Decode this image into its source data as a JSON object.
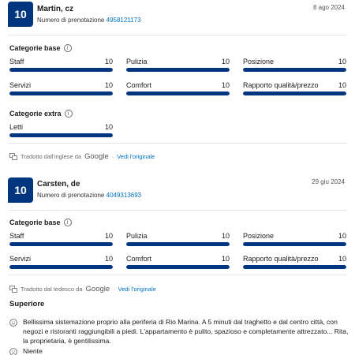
{
  "reviews": [
    {
      "score": "10",
      "name": "Martin, cz",
      "booking_label": "Numero di prenotazione",
      "booking_number": "4958121173",
      "date": "8 ago 2024",
      "base_title": "Categorie base",
      "base": [
        {
          "label": "Staff",
          "value": "10",
          "fill": 1.0
        },
        {
          "label": "Pulizia",
          "value": "10",
          "fill": 1.0
        },
        {
          "label": "Posizione",
          "value": "10",
          "fill": 1.0
        },
        {
          "label": "Servizi",
          "value": "10",
          "fill": 1.0
        },
        {
          "label": "Comfort",
          "value": "10",
          "fill": 1.0
        },
        {
          "label": "Rapporto qualità/prezzo",
          "value": "10",
          "fill": 1.0
        }
      ],
      "extra_title": "Categorie extra",
      "extra": [
        {
          "label": "Letti",
          "value": "10",
          "fill": 1.0
        }
      ],
      "translated_from": "Tradotto dall'inglese da",
      "google": "Google",
      "see_original": "Vedi l'originale"
    },
    {
      "score": "10",
      "name": "Carsten, de",
      "booking_label": "Numero di prenotazione",
      "booking_number": "4049313693",
      "date": "29 giu 2024",
      "base_title": "Categorie base",
      "base": [
        {
          "label": "Staff",
          "value": "10",
          "fill": 1.0
        },
        {
          "label": "Pulizia",
          "value": "10",
          "fill": 1.0
        },
        {
          "label": "Posizione",
          "value": "10",
          "fill": 1.0
        },
        {
          "label": "Servizi",
          "value": "10",
          "fill": 1.0
        },
        {
          "label": "Comfort",
          "value": "10",
          "fill": 1.0
        },
        {
          "label": "Rapporto qualità/prezzo",
          "value": "10",
          "fill": 1.0
        }
      ],
      "translated_from": "Tradotto dal tedesco da",
      "google": "Google",
      "see_original": "Vedi l'originale",
      "heading": "Superiore",
      "positive": "Bellissima sistemazione proprio alla periferia di Rio Marina. A 5 minuti dal traghetto e dal centro città, con negozi e ristoranti raggiungibili a piedi. L'appartamento è pulito, spazioso e completamente attrezzato... Rita, la proprietaria, è gentilissima.",
      "negative": "Niente"
    }
  ],
  "colors": {
    "brand": "#003580",
    "link": "#0071c2",
    "track": "#e7e7e7"
  }
}
